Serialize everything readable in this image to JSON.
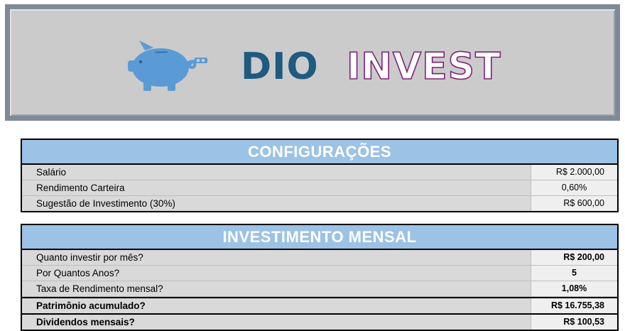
{
  "header": {
    "title_part1": "DIO",
    "title_part2": "INVEST",
    "logo_icon": "piggy-bank-icon",
    "colors": {
      "title_part1": "#1f5a80",
      "title_part2_outline": "#7e1f76",
      "piggy": "#5b9bd5"
    }
  },
  "config": {
    "title": "CONFIGURAÇÕES",
    "rows": [
      {
        "label": "Salário",
        "value": "R$ 2.000,00"
      },
      {
        "label": "Rendimento Carteira",
        "value": "0,60%"
      },
      {
        "label": "Sugestão de Investimento (30%)",
        "value": "R$ 600,00"
      }
    ]
  },
  "monthly": {
    "title": "INVESTIMENTO MENSAL",
    "rows": [
      {
        "label": "Quanto investir por mês?",
        "value": "R$ 200,00"
      },
      {
        "label": "Por Quantos Anos?",
        "value": "5"
      },
      {
        "label": "Taxa de Rendimento mensal?",
        "value": "1,08%"
      },
      {
        "label": "Patrimônio acumulado?",
        "value": "R$ 16.755,38"
      },
      {
        "label": "Dividendos mensais?",
        "value": "R$ 100,53"
      }
    ]
  },
  "colors": {
    "header_band": "#9cc2e5",
    "row_bg": "#d9d9d9"
  }
}
